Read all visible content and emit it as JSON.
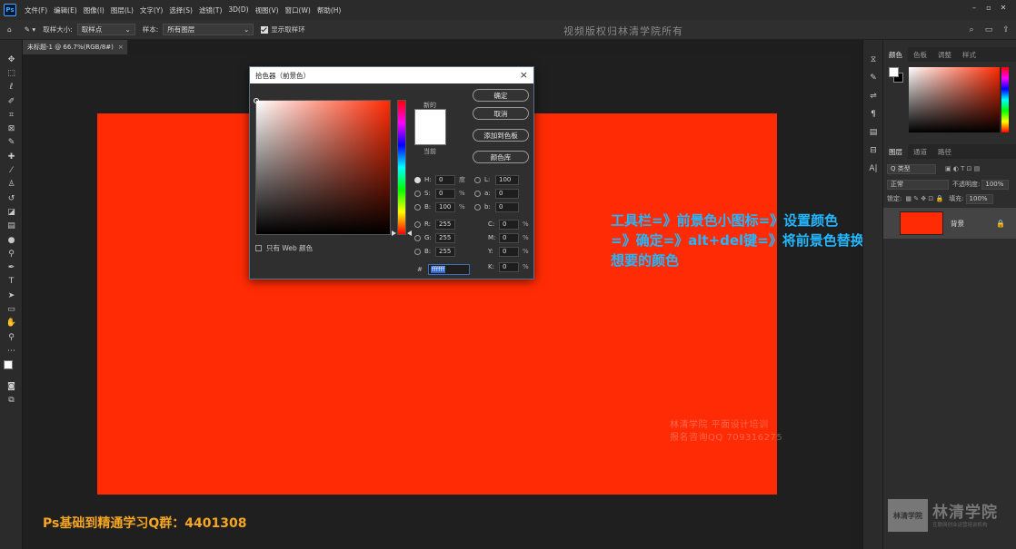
{
  "menubar": {
    "logo": "Ps",
    "items": [
      "文件(F)",
      "编辑(E)",
      "图像(I)",
      "图层(L)",
      "文字(Y)",
      "选择(S)",
      "滤镜(T)",
      "3D(D)",
      "视图(V)",
      "窗口(W)",
      "帮助(H)"
    ],
    "window_controls": [
      "–",
      "▫",
      "✕"
    ]
  },
  "options": {
    "sample_size_label": "取样大小:",
    "sample_size_value": "取样点",
    "sample_label": "样本:",
    "sample_value": "所有图层",
    "show_ring_label": "显示取样环",
    "watermark": "视频版权归林清学院所有"
  },
  "document": {
    "tab_title": "未标题-1 @ 66.7%(RGB/8#)",
    "tab_close": "×"
  },
  "annotation": {
    "line1": "工具栏=》前景色小图标=》设置颜色",
    "line2": "=》确定=》alt+del键=》将前景色替换为",
    "line3": "想要的颜色"
  },
  "canvas_watermark": {
    "line1": "林清学院  平面设计培训",
    "line2": "报名咨询QQ 709316275"
  },
  "footer": {
    "qq_group": "Ps基础到精通学习Q群：4401308"
  },
  "color_picker": {
    "title": "拾色器（前景色）",
    "close": "×",
    "label_new": "新的",
    "label_current": "当前",
    "btn_ok": "确定",
    "btn_cancel": "取消",
    "btn_add_swatch": "添加到色板",
    "btn_library": "颜色库",
    "web_only": "只有 Web 颜色",
    "hsb": [
      {
        "label": "H:",
        "value": "0",
        "unit": "度",
        "selected": true
      },
      {
        "label": "S:",
        "value": "0",
        "unit": "%",
        "selected": false
      },
      {
        "label": "B:",
        "value": "100",
        "unit": "%",
        "selected": false
      }
    ],
    "rgb": [
      {
        "label": "R:",
        "value": "255"
      },
      {
        "label": "G:",
        "value": "255"
      },
      {
        "label": "B:",
        "value": "255"
      }
    ],
    "lab": [
      {
        "label": "L:",
        "value": "100"
      },
      {
        "label": "a:",
        "value": "0"
      },
      {
        "label": "b:",
        "value": "0"
      }
    ],
    "cmyk": [
      {
        "label": "C:",
        "value": "0",
        "unit": "%"
      },
      {
        "label": "M:",
        "value": "0",
        "unit": "%"
      },
      {
        "label": "Y:",
        "value": "0",
        "unit": "%"
      },
      {
        "label": "K:",
        "value": "0",
        "unit": "%"
      }
    ],
    "hex_label": "#",
    "hex_value": "ffffff"
  },
  "panels": {
    "color_tabs": [
      "颜色",
      "色板",
      "调整",
      "样式"
    ],
    "layer_tabs": [
      "图层",
      "通道",
      "路径"
    ],
    "kind_filter": "Q 类型",
    "blend_mode": "正常",
    "opacity_label": "不透明度:",
    "opacity_value": "100%",
    "lock_label": "锁定:",
    "fill_label": "填充:",
    "fill_value": "100%",
    "layer_name": "背景",
    "lock_icon": "🔒"
  },
  "brand": {
    "logo_box": "林清学院",
    "logo_text": "林清学院",
    "logo_sub": "互联网创业运营培训机构"
  },
  "colors": {
    "canvas_fill": "#ff2b04",
    "annotation": "#22b7ff",
    "qq_text": "#f5a623"
  }
}
